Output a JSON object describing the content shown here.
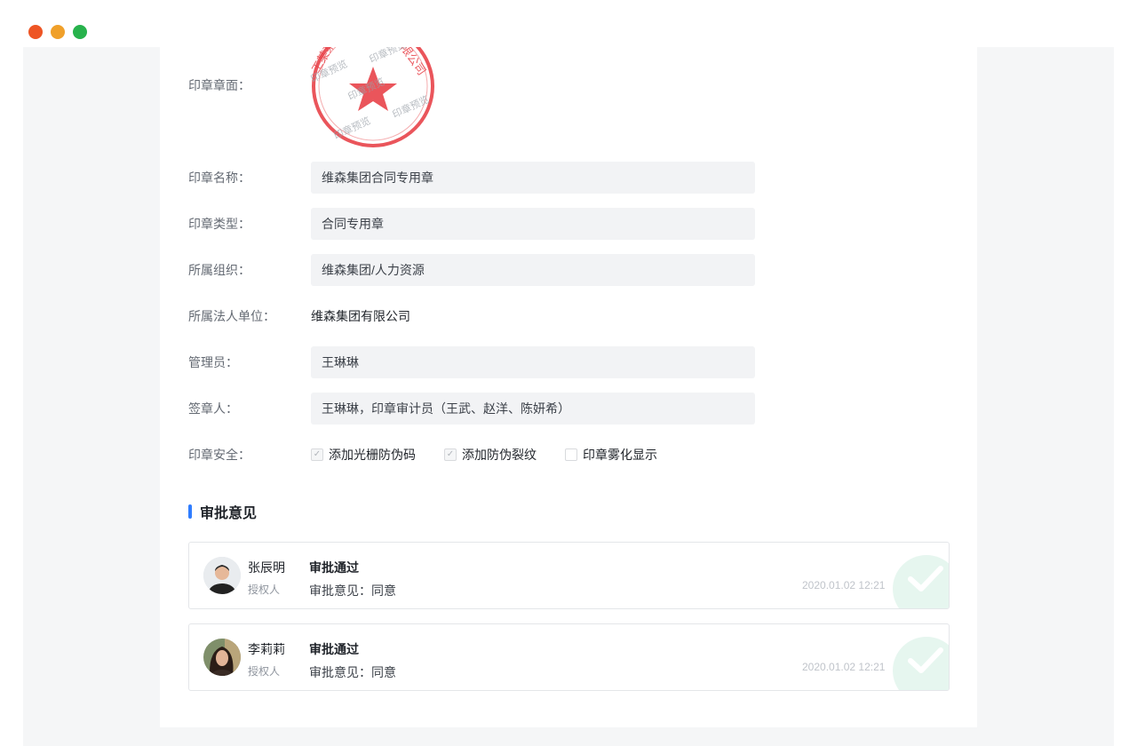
{
  "window": {
    "controls": [
      "close",
      "minimize",
      "maximize"
    ]
  },
  "seal": {
    "preview_text": "印章预览",
    "stamp_ring_text": "工某某某有限公司",
    "color": "#e8434a"
  },
  "form": {
    "seal_face_label": "印章章面：",
    "seal_name": {
      "label": "印章名称：",
      "value": "维森集团合同专用章"
    },
    "seal_type": {
      "label": "印章类型：",
      "value": "合同专用章"
    },
    "org": {
      "label": "所属组织：",
      "value": "维森集团/人力资源"
    },
    "legal_unit": {
      "label": "所属法人单位：",
      "value": "维森集团有限公司"
    },
    "admin": {
      "label": "管理员：",
      "value": "王琳琳"
    },
    "signers": {
      "label": "签章人：",
      "value": "王琳琳，印章审计员（王武、赵洋、陈妍希）"
    },
    "security": {
      "label": "印章安全：",
      "options": [
        {
          "label": "添加光栅防伪码",
          "checked": true
        },
        {
          "label": "添加防伪裂纹",
          "checked": true
        },
        {
          "label": "印章雾化显示",
          "checked": false
        }
      ]
    }
  },
  "approvals": {
    "title": "审批意见",
    "accent": "#2f7dff",
    "items": [
      {
        "name": "张辰明",
        "role": "授权人",
        "status": "审批通过",
        "opinion": "审批意见：同意",
        "time": "2020.01.02 12:21"
      },
      {
        "name": "李莉莉",
        "role": "授权人",
        "status": "审批通过",
        "opinion": "审批意见：同意",
        "time": "2020.01.02 12:21"
      }
    ]
  }
}
